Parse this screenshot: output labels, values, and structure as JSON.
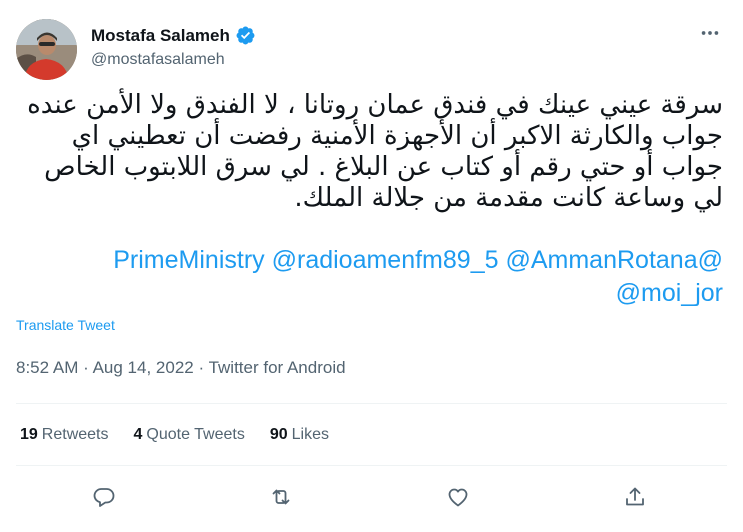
{
  "author": {
    "display_name": "Mostafa Salameh",
    "handle": "@mostafasalameh"
  },
  "tweet": {
    "text": "سرقة عيني عينك في فندق عمان روتانا ، لا الفندق ولا الأمن عنده جواب والكارثة الاكبر أن الأجهزة الأمنية رفضت أن تعطيني اي جواب أو حتي رقم أو كتاب عن البلاغ . لي سرق اللابتوب الخاص لي وساعة كانت مقدمة من جلالة الملك.",
    "mentions": [
      "@PrimeMinistry",
      "@radioamenfm89_5",
      "@AmmanRotana",
      "@moi_jor"
    ],
    "translate_label": "Translate Tweet",
    "time": "8:52 AM",
    "separator": "·",
    "date": "Aug 14, 2022",
    "source": "Twitter for Android"
  },
  "stats": {
    "retweets_count": "19",
    "retweets_label": "Retweets",
    "quotes_count": "4",
    "quotes_label": "Quote Tweets",
    "likes_count": "90",
    "likes_label": "Likes"
  },
  "icons": {
    "more": "more-horizontal-icon",
    "verified": "verified-badge-icon",
    "reply": "reply-icon",
    "retweet": "retweet-icon",
    "like": "heart-icon",
    "share": "share-icon"
  },
  "colors": {
    "accent": "#1d9bf0",
    "secondary_text": "#536471",
    "primary_text": "#0f1419"
  }
}
